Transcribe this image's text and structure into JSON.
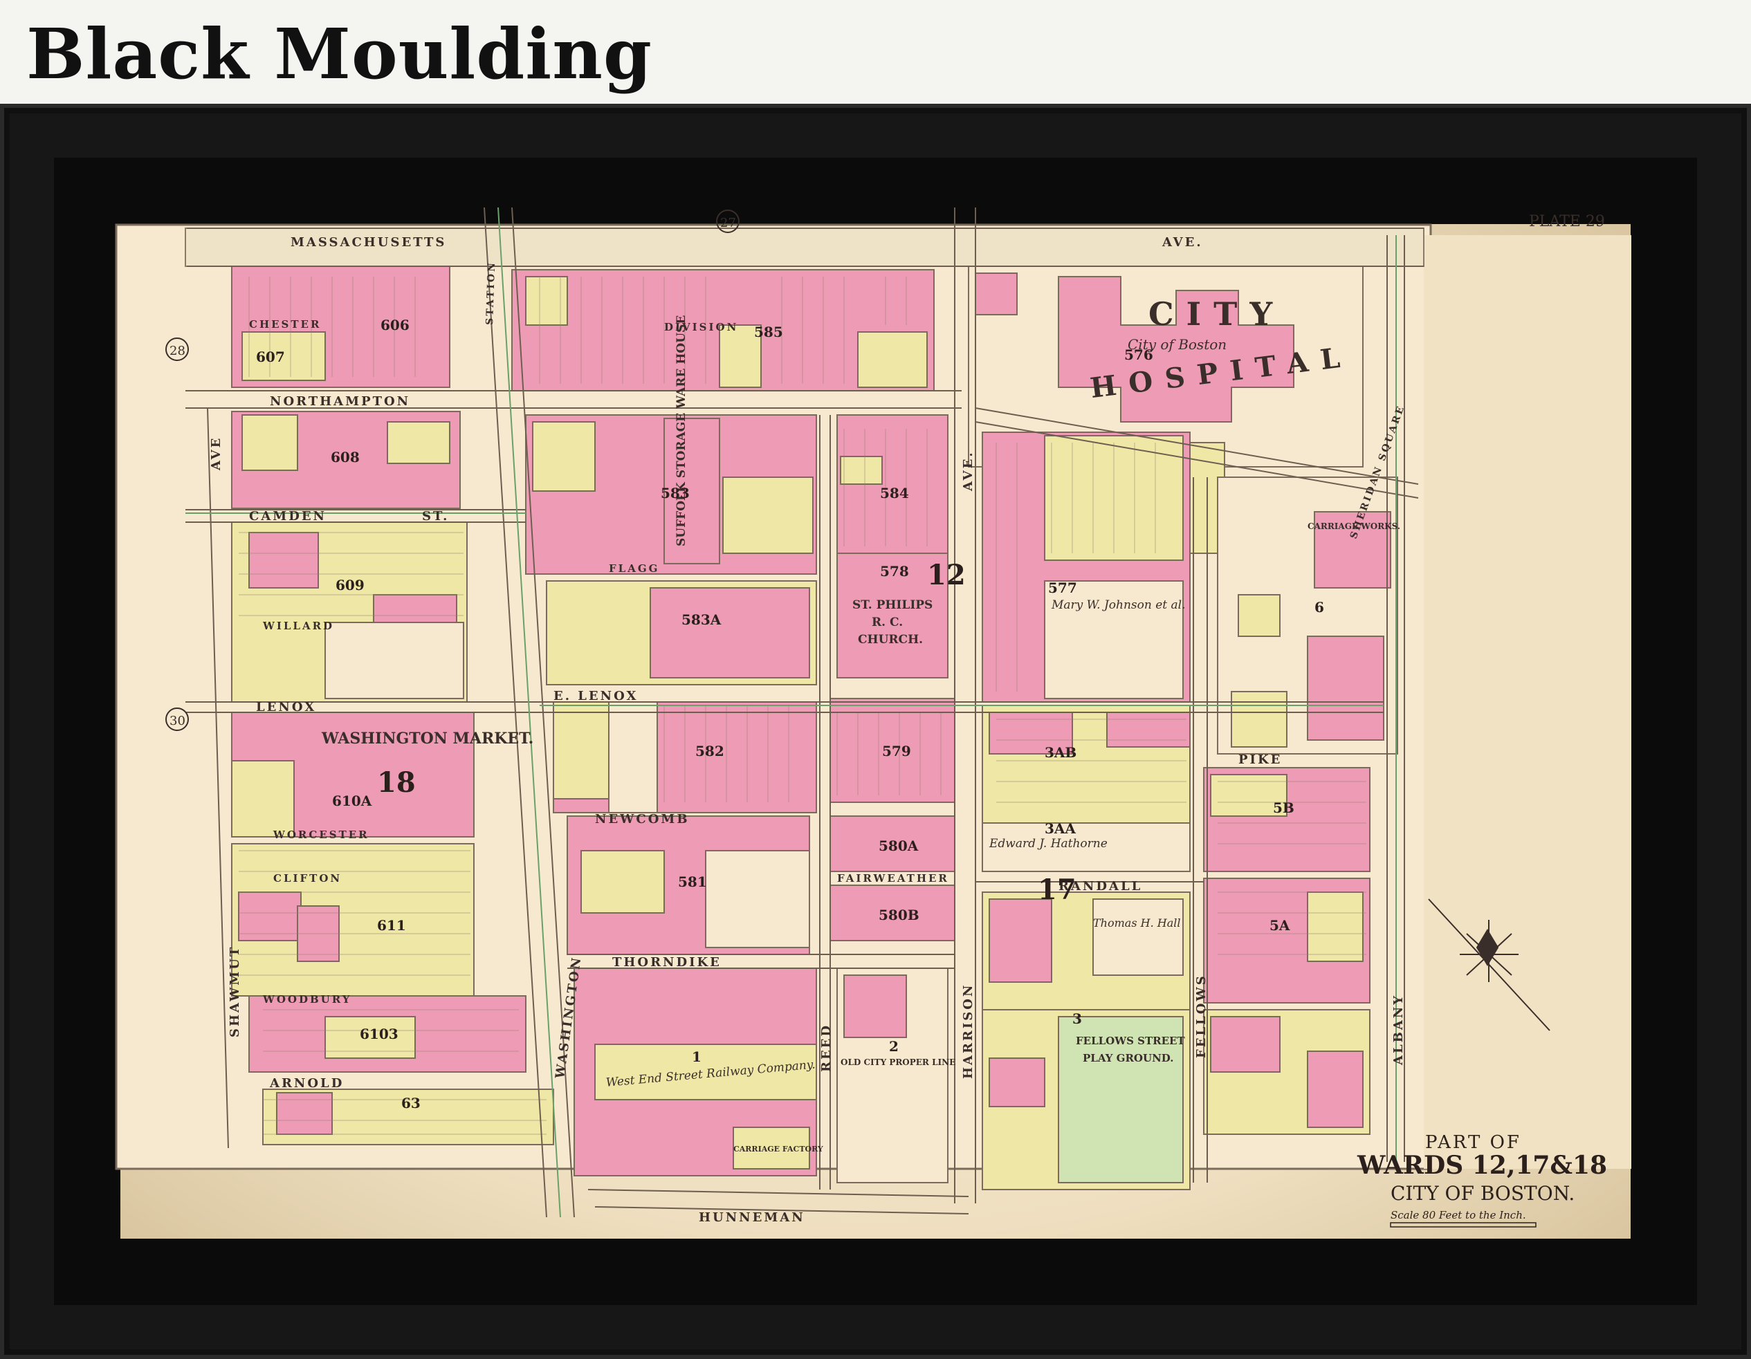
{
  "heading": "Black Moulding",
  "colors": {
    "pink": "#ee9cb6",
    "yellow": "#eee7a6",
    "green": "#cfe3b3",
    "paper": "#f6e9cf",
    "ink": "#3a2e2a"
  },
  "plate": "PLATE 29",
  "plate_numbers": [
    "27",
    "28",
    "30"
  ],
  "title_block": {
    "line1": "PART OF",
    "line2": "WARDS 12,17&18",
    "line3": "CITY OF BOSTON.",
    "line4": "Scale 80 Feet to the Inch."
  },
  "streets": {
    "massachusetts": "MASSACHUSETTS",
    "ave_top": "AVE.",
    "northampton": "NORTHAMPTON",
    "camden": "CAMDEN",
    "camden_st": "ST.",
    "lenox": "LENOX",
    "e_lenox": "E. LENOX",
    "newcomb": "NEWCOMB",
    "thorndike": "THORNDIKE",
    "arnold": "ARNOLD",
    "hunneman": "HUNNEMAN",
    "shawmut": "SHAWMUT",
    "shawmut_ave": "AVE",
    "washington": "WASHINGTON",
    "harrison": "HARRISON",
    "harrison_ave": "AVE.",
    "reed": "REED",
    "fellows": "FELLOWS",
    "albany": "ALBANY",
    "randall": "RANDALL",
    "pike": "PIKE",
    "fairweather": "FAIRWEATHER",
    "chester": "CHESTER",
    "willard": "WILLARD",
    "worcester": "WORCESTER",
    "clifton": "CLIFTON",
    "woodbury": "WOODBURY",
    "division": "DIVISION",
    "flagg": "FLAGG",
    "station": "STATION",
    "sheridan_square": "SHERIDAN SQUARE"
  },
  "labels": {
    "city_hospital_1": "CITY",
    "city_hospital_2": "HOSPITAL",
    "city_of_boston": "City of Boston",
    "washington_market": "WASHINGTON MARKET.",
    "st_philips": "ST. PHILIPS",
    "rc_church": "R. C.",
    "church": "CHURCH.",
    "suffolk": "SUFFOLK STORAGE WARE HOUSE",
    "west_end": "West End Street Railway Company.",
    "play_ground_1": "FELLOWS STREET",
    "play_ground_2": "PLAY GROUND.",
    "carriage_works": "CARRIAGE WORKS.",
    "carriage_factory": "CARRIAGE FACTORY",
    "mary_johnson": "Mary W. Johnson et al.",
    "edward_hathorne": "Edward J. Hathorne",
    "thomas_hall": "Thomas H. Hall",
    "old_city": "OLD CITY PROPER LINE"
  },
  "block_numbers": [
    "576",
    "583",
    "584",
    "578",
    "583A",
    "582",
    "579",
    "580A",
    "580B",
    "581",
    "577",
    "3AB",
    "3AA",
    "17",
    "12",
    "18",
    "610A",
    "611",
    "6103",
    "606",
    "607",
    "608",
    "609",
    "585",
    "1",
    "2",
    "3",
    "5A",
    "5B",
    "6",
    "63"
  ]
}
